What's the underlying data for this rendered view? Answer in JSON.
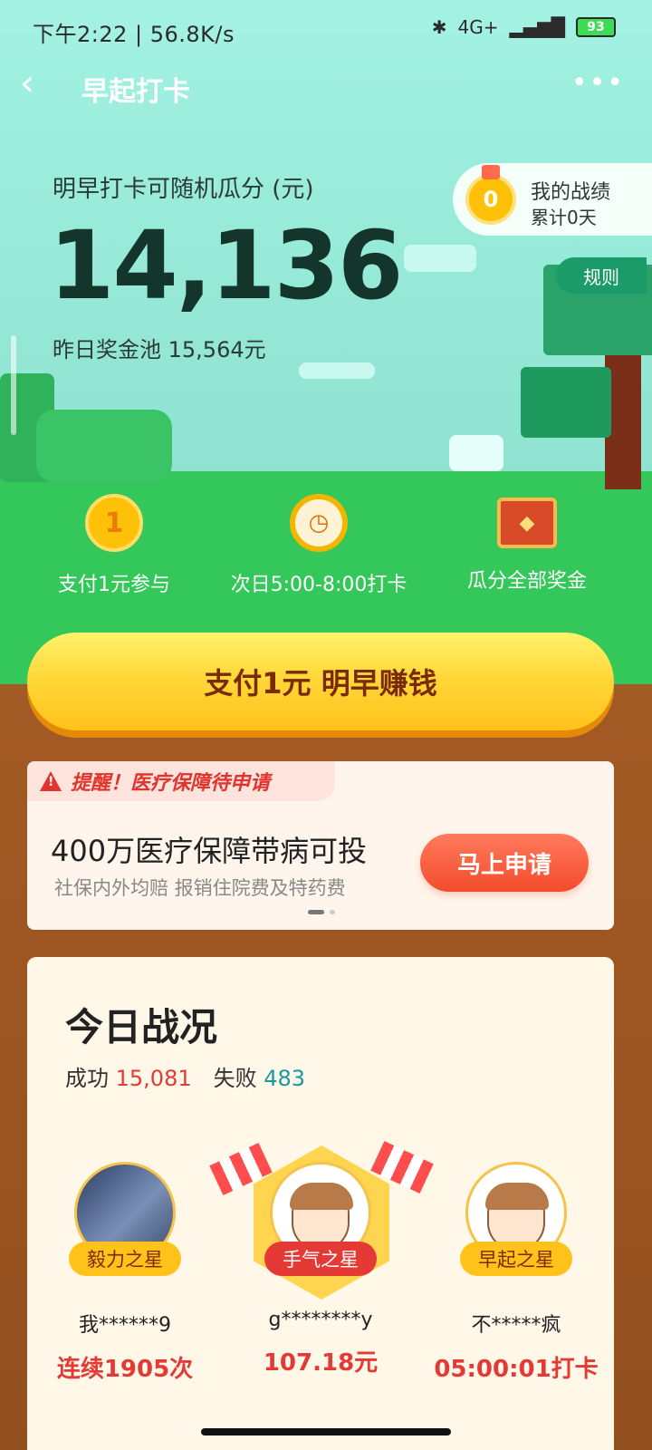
{
  "status_bar": {
    "time_speed": "下午2:22 | 56.8K/s",
    "network": "4G+",
    "battery": "93"
  },
  "nav": {
    "title": "早起打卡"
  },
  "hero": {
    "pool_label": "明早打卡可随机瓜分 (元)",
    "pool_amount": "14,136",
    "yesterday_pool": "昨日奖金池 15,564元",
    "record_title": "我的战绩",
    "record_sub": "累计0天",
    "medal_value": "0",
    "rules_label": "规则"
  },
  "steps": [
    {
      "label": "支付1元参与",
      "icon": "coin-icon"
    },
    {
      "label": "次日5:00-8:00打卡",
      "icon": "alarm-clock-icon"
    },
    {
      "label": "瓜分全部奖金",
      "icon": "treasure-chest-icon"
    }
  ],
  "cta": {
    "label": "支付1元 明早赚钱"
  },
  "notice": {
    "tag": "提醒！医疗保障待申请",
    "title": "400万医疗保障带病可投",
    "subtitle": "社保内外均赔 报销住院费及特药费",
    "button": "马上申请"
  },
  "today": {
    "title": "今日战况",
    "success_label": "成功",
    "success_value": "15,081",
    "fail_label": "失败",
    "fail_value": "483",
    "stars": [
      {
        "badge": "毅力之星",
        "name": "我******9",
        "value": "连续1905次"
      },
      {
        "badge": "手气之星",
        "name": "g********y",
        "value": "107.18元"
      },
      {
        "badge": "早起之星",
        "name": "不*****疯",
        "value": "05:00:01打卡"
      }
    ]
  },
  "colors": {
    "sky": "#a3f2e3",
    "grass": "#34c759",
    "ground": "#a35a24",
    "cta": "#ffd83a",
    "accent_red": "#e53935"
  }
}
